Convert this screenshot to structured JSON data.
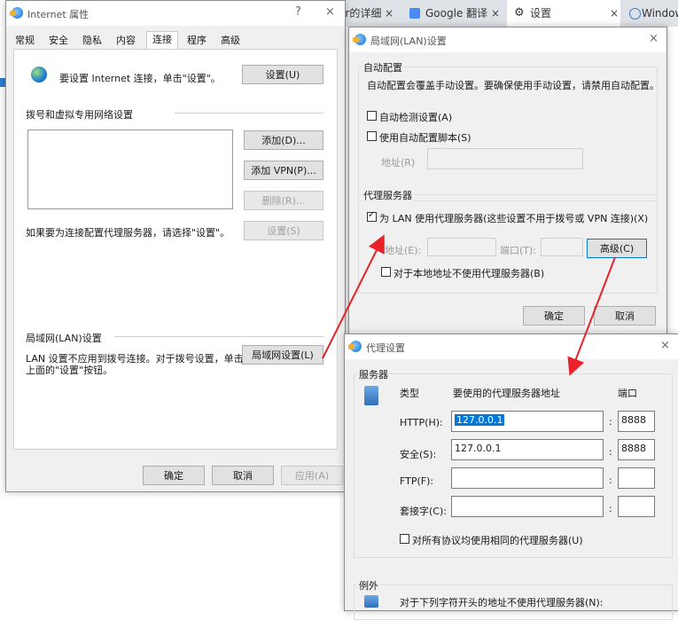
{
  "browser": {
    "tab1": "er的详细",
    "tab1_close": "×",
    "tab2": "Google 翻译",
    "tab2_close": "×",
    "tab3": "设置",
    "tab3_close": "×",
    "tab4": "Windows us"
  },
  "inet": {
    "title": "Internet 属性",
    "help": "?",
    "close": "×",
    "tabs": [
      "常规",
      "安全",
      "隐私",
      "内容",
      "连接",
      "程序",
      "高级"
    ],
    "setup_text": "要设置 Internet 连接，单击\"设置\"。",
    "setup_btn": "设置(U)",
    "dialup_title": "拨号和虚拟专用网络设置",
    "add_btn": "添加(D)...",
    "add_vpn_btn": "添加 VPN(P)...",
    "remove_btn": "删除(R)...",
    "proxy_hint": "如果要为连接配置代理服务器，请选择\"设置\"。",
    "settings_btn": "设置(S)",
    "lan_title": "局域网(LAN)设置",
    "lan_desc1": "LAN 设置不应用到拨号连接。对于拨号设置，单击",
    "lan_desc2": "上面的\"设置\"按钮。",
    "lan_btn": "局域网设置(L)",
    "ok": "确定",
    "cancel": "取消",
    "apply": "应用(A)"
  },
  "lan": {
    "title": "局域网(LAN)设置",
    "close": "×",
    "auto_title": "自动配置",
    "auto_desc": "自动配置会覆盖手动设置。要确保使用手动设置，请禁用自动配置。",
    "auto_detect": "自动检测设置(A)",
    "auto_script": "使用自动配置脚本(S)",
    "address_label": "地址(R)",
    "proxy_title": "代理服务器",
    "use_proxy": "为 LAN 使用代理服务器(这些设置不用于拨号或 VPN 连接)(X)",
    "addr_label": "地址(E):",
    "port_label": "端口(T):",
    "advanced_btn": "高级(C)",
    "bypass_local": "对于本地地址不使用代理服务器(B)",
    "ok": "确定",
    "cancel": "取消"
  },
  "proxy": {
    "title": "代理设置",
    "close": "×",
    "servers_title": "服务器",
    "col_type": "类型",
    "col_addr": "要使用的代理服务器地址",
    "col_port": "端口",
    "rows": [
      {
        "label": "HTTP(H):",
        "addr": "127.0.0.1",
        "port": "8888"
      },
      {
        "label": "安全(S):",
        "addr": "127.0.0.1",
        "port": "8888"
      },
      {
        "label": "FTP(F):",
        "addr": "",
        "port": ""
      },
      {
        "label": "套接字(C):",
        "addr": "",
        "port": ""
      }
    ],
    "colon": ":",
    "same_proxy": "对所有协议均使用相同的代理服务器(U)",
    "exceptions_title": "例外",
    "exceptions_desc": "对于下列字符开头的地址不使用代理服务器(N):"
  },
  "colors": {
    "accent": "#0078d7",
    "arrow": "#e8212b"
  }
}
